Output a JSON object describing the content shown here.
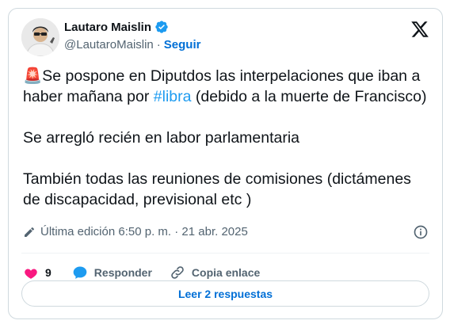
{
  "author": {
    "name": "Lautaro Maislin",
    "handle": "@LautaroMaislin",
    "separator": "·",
    "follow_label": "Seguir"
  },
  "tweet": {
    "emoji": "🚨",
    "text_part1": "Se pospone en Diputdos las interpelaciones que iban a haber mañana por ",
    "hashtag": "#libra",
    "text_part2": " (debido a la muerte de Francisco)\n\nSe arregló recién en labor parlamentaria\n\nTambién todas las reuniones de comisiones (dictámenes de discapacidad, previsional etc )"
  },
  "meta": {
    "edited_label": "Última edición 6:50 p. m. · 21 abr. 2025"
  },
  "actions": {
    "likes_count": "9",
    "reply_label": "Responder",
    "copy_link_label": "Copia enlace"
  },
  "replies_button": "Leer 2 respuestas",
  "colors": {
    "accent": "#1d9bf0",
    "link": "#006fd6",
    "like": "#f91880",
    "muted": "#536471",
    "border": "#cfd9de"
  }
}
